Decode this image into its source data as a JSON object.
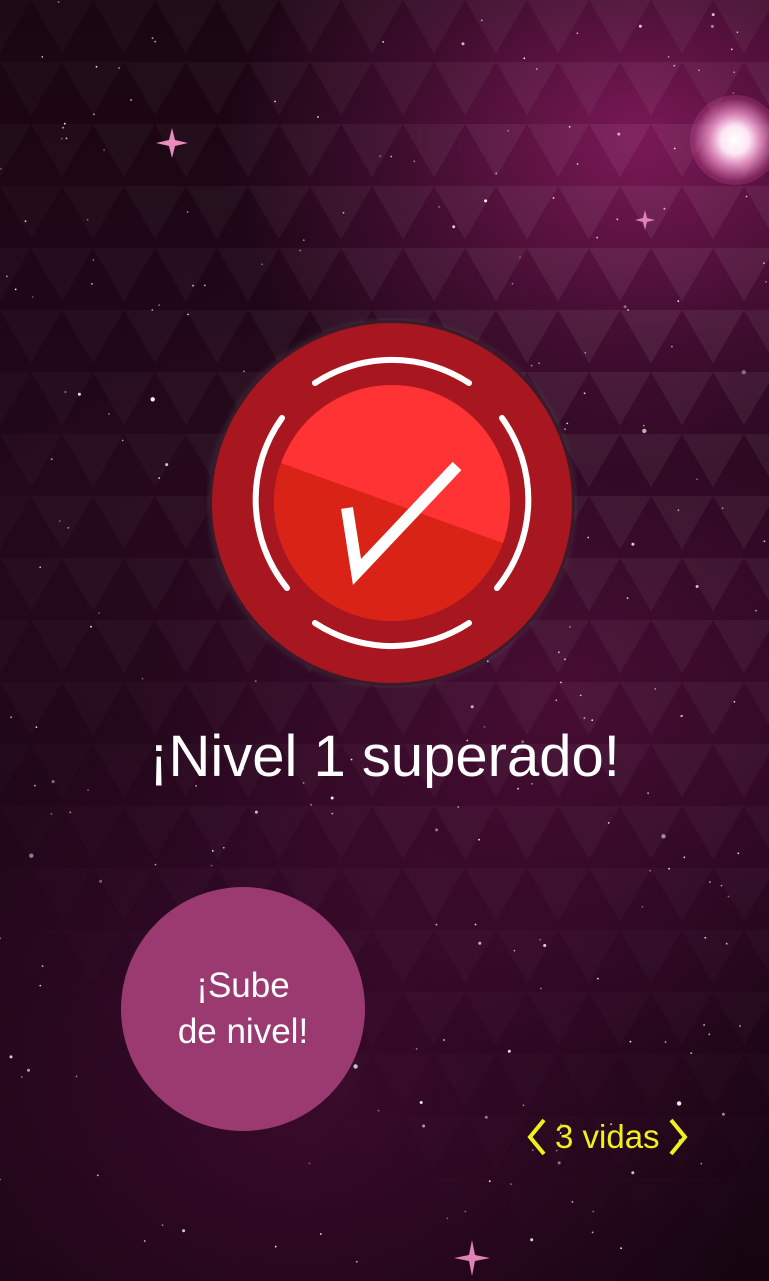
{
  "screen": {
    "title": "¡Nivel 1 superado!",
    "badge_icon": "checkmark-icon"
  },
  "levelup_button": {
    "line1": "¡Sube",
    "line2": "de nivel!"
  },
  "lives": {
    "label": "3 vidas",
    "prev_icon": "chevron-left-icon",
    "next_icon": "chevron-right-icon"
  },
  "colors": {
    "badge_outer": "#a8161f",
    "badge_inner_light": "#ff3334",
    "badge_inner_dark": "#d82316",
    "button": "#9a3a70",
    "lives_text": "#eef21c",
    "title_text": "#ffffff"
  }
}
